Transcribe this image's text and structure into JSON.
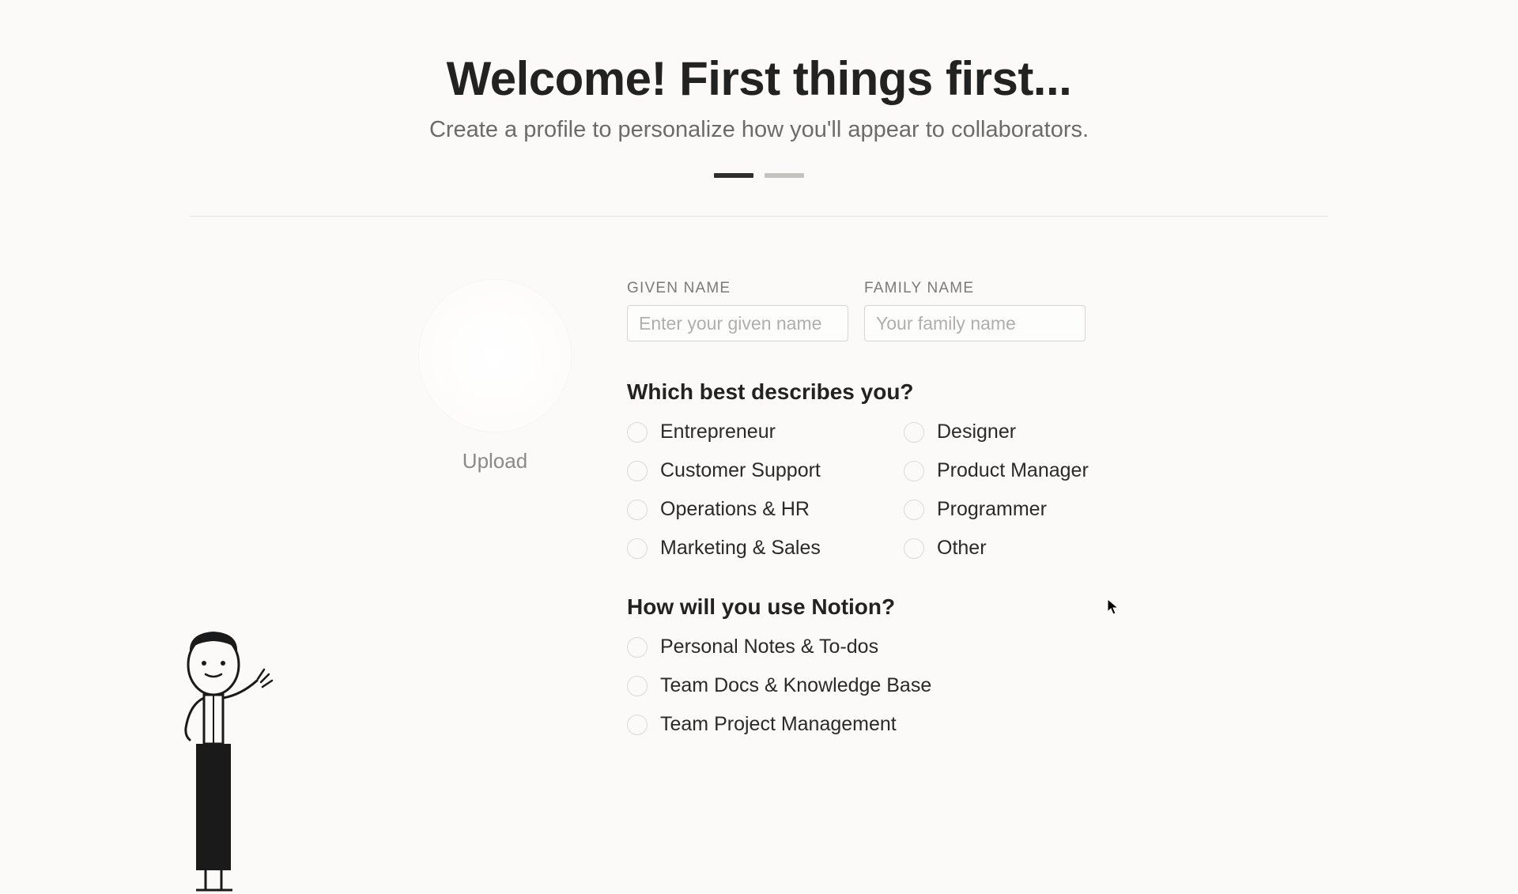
{
  "header": {
    "title": "Welcome! First things first...",
    "subtitle": "Create a profile to personalize how you'll appear to collaborators."
  },
  "progress": {
    "current_step": 1,
    "total_steps": 2
  },
  "avatar": {
    "upload_label": "Upload"
  },
  "name_fields": {
    "given_name": {
      "label": "GIVEN NAME",
      "placeholder": "Enter your given name",
      "value": ""
    },
    "family_name": {
      "label": "FAMILY NAME",
      "placeholder": "Your family name",
      "value": ""
    }
  },
  "question_role": {
    "heading": "Which best describes you?",
    "options": [
      "Entrepreneur",
      "Designer",
      "Customer Support",
      "Product Manager",
      "Operations & HR",
      "Programmer",
      "Marketing & Sales",
      "Other"
    ]
  },
  "question_usage": {
    "heading": "How will you use Notion?",
    "options": [
      "Personal Notes & To-dos",
      "Team Docs & Knowledge Base",
      "Team Project Management"
    ]
  }
}
